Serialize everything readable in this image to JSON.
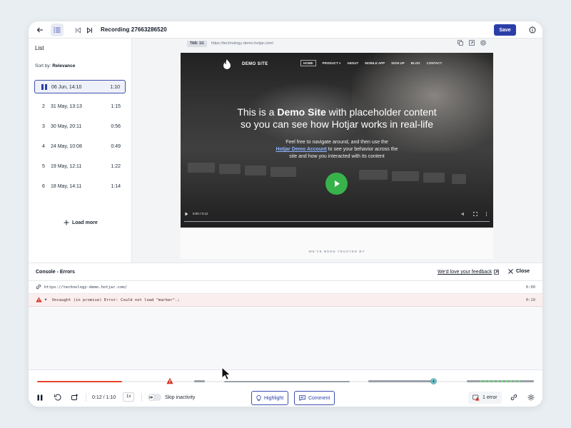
{
  "header": {
    "title": "Recording 27663286520",
    "save_label": "Save"
  },
  "sidebar": {
    "title": "List",
    "sort_prefix": "Sort by:",
    "sort_value": "Relevance",
    "items": [
      {
        "num": "",
        "date": "06 Jun, 14:10",
        "duration": "1:10",
        "active": true
      },
      {
        "num": "2",
        "date": "31 May, 13:13",
        "duration": "1:15"
      },
      {
        "num": "3",
        "date": "30 May, 20:11",
        "duration": "0:56"
      },
      {
        "num": "4",
        "date": "24 May, 10:08",
        "duration": "0:49"
      },
      {
        "num": "5",
        "date": "19 May, 12:11",
        "duration": "1:22"
      },
      {
        "num": "6",
        "date": "18 May, 14:11",
        "duration": "1:14"
      }
    ],
    "load_more": "Load more"
  },
  "player": {
    "tab_label": "TAB: 1/1",
    "url": "https://technology-demo.hotjar.com/",
    "site": {
      "brand": "DEMO SITE",
      "nav": [
        "HOME",
        "PRODUCT ▾",
        "ABOUT",
        "MOBILE APP",
        "SIGN UP",
        "BLOG",
        "CONTACT"
      ],
      "headline_1a": "This is a ",
      "headline_1b": "Demo Site",
      "headline_1c": " with placeholder content",
      "headline_2": "so you can see how Hotjar works in real-life",
      "sub_1": "Feel free to navigate around, and then use the",
      "sub_link": "Hotjar Demo Account",
      "sub_2": " to see your behavior across the",
      "sub_3": "site and how you interacted with its content",
      "video_time": "0:00 / 0:12",
      "trusted": "WE'VE BEEN TRUSTED BY"
    }
  },
  "console": {
    "title": "Console - Errors",
    "feedback": "We'd love your feedback",
    "close": "Close",
    "rows": [
      {
        "type": "url",
        "text": "https://technology-demo.hotjar.com/",
        "time": "0:00"
      },
      {
        "type": "error",
        "text": "Uncaught (in promise) Error: Could not load \"marker\".;",
        "time": "0:19"
      }
    ]
  },
  "controls": {
    "time": "0:12 / 1:10",
    "speed": "1x",
    "skip_inactivity": "Skip inactivity",
    "highlight": "Highlight",
    "comment": "Comment",
    "errors": "1 error",
    "progress_fraction": 0.171
  },
  "colors": {
    "accent": "#2b3ea8",
    "progress": "#e8452c",
    "error": "#d93025",
    "play": "#38b24a"
  }
}
